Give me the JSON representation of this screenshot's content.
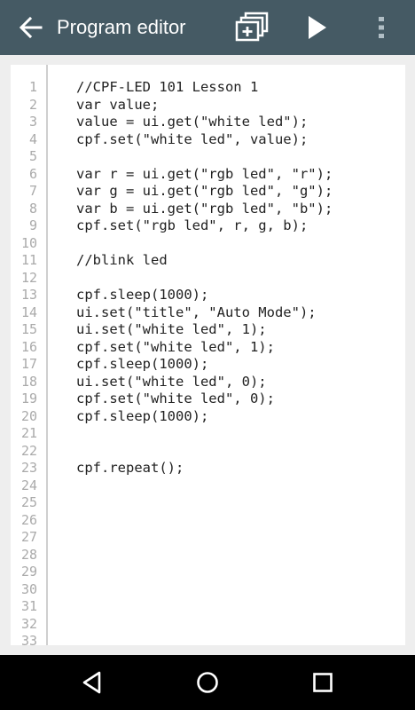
{
  "appbar": {
    "title": "Program editor",
    "back_icon": "arrow-left-icon",
    "add_icon": "add-to-library-icon",
    "run_icon": "play-icon",
    "more_icon": "more-vert-icon",
    "background_color": "#455a64"
  },
  "editor": {
    "line_numbers": [
      "1",
      "2",
      "3",
      "4",
      "5",
      "6",
      "7",
      "8",
      "9",
      "10",
      "11",
      "12",
      "13",
      "14",
      "15",
      "16",
      "17",
      "18",
      "19",
      "20",
      "21",
      "22",
      "23",
      "24",
      "25",
      "26",
      "27",
      "28",
      "29",
      "30",
      "31",
      "32",
      "33"
    ],
    "lines": [
      "//CPF-LED 101 Lesson 1",
      "var value;",
      "value = ui.get(\"white led\");",
      "cpf.set(\"white led\", value);",
      "",
      "var r = ui.get(\"rgb led\", \"r\");",
      "var g = ui.get(\"rgb led\", \"g\");",
      "var b = ui.get(\"rgb led\", \"b\");",
      "cpf.set(\"rgb led\", r, g, b);",
      "",
      "//blink led",
      "",
      "cpf.sleep(1000);",
      "ui.set(\"title\", \"Auto Mode\");",
      "ui.set(\"white led\", 1);",
      "cpf.set(\"white led\", 1);",
      "cpf.sleep(1000);",
      "ui.set(\"white led\", 0);",
      "cpf.set(\"white led\", 0);",
      "cpf.sleep(1000);",
      "",
      "",
      "cpf.repeat();"
    ]
  },
  "navbar": {
    "back_icon": "nav-back-icon",
    "home_icon": "nav-home-icon",
    "recents_icon": "nav-recents-icon"
  }
}
